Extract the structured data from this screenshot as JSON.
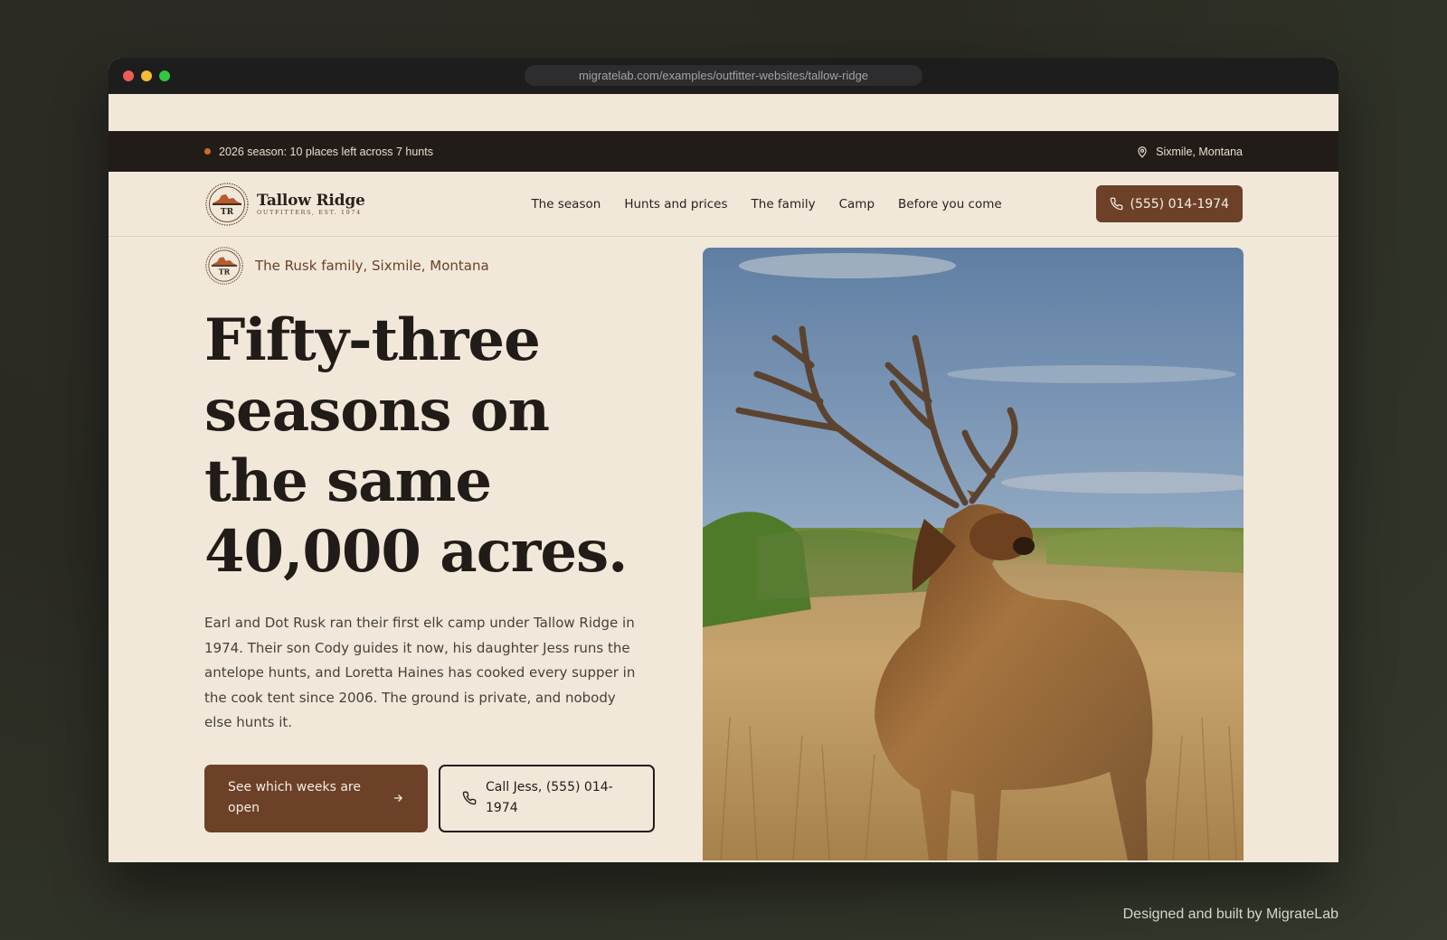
{
  "browser": {
    "url": "migratelab.com/examples/outfitter-websites/tallow-ridge"
  },
  "announcement": {
    "season_text": "2026 season: 10 places left across 7 hunts",
    "location": "Sixmile, Montana"
  },
  "brand": {
    "name": "Tallow Ridge",
    "tagline": "OUTFITTERS, EST. 1974",
    "monogram": "TR"
  },
  "nav": {
    "links": [
      "The season",
      "Hunts and prices",
      "The family",
      "Camp",
      "Before you come"
    ],
    "phone_button": "(555) 014-1974"
  },
  "hero": {
    "eyebrow": "The Rusk family, Sixmile, Montana",
    "headline": "Fifty-three seasons on the same 40,000 acres.",
    "body": "Earl and Dot Rusk ran their first elk camp under Tallow Ridge in 1974. Their son Cody guides it now, his daughter Jess runs the antelope hunts, and Loretta Haines has cooked every supper in the cook tent since 2006. The ground is private, and nobody else hunts it.",
    "primary_cta": "See which weeks are open",
    "secondary_cta": "Call Jess, (555) 014-1974"
  },
  "footer_credit": "Designed and built by MigrateLab",
  "colors": {
    "brand_brown": "#6c4128",
    "dark": "#221c18",
    "cream": "#f1e8da",
    "accent_orange": "#d2692b"
  },
  "icons": {
    "location": "map-pin-icon",
    "phone": "phone-icon",
    "arrow": "arrow-right-icon"
  }
}
